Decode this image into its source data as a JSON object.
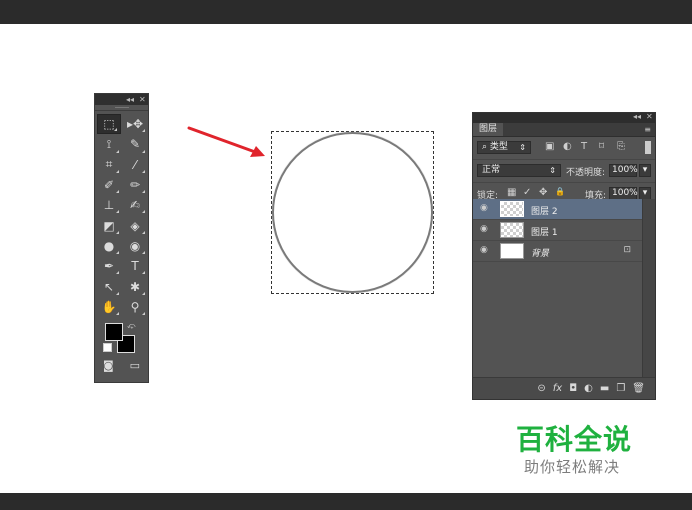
{
  "tools_panel": {
    "collapse_glyph": "◂◂",
    "close_glyph": "✕",
    "tools": [
      {
        "name": "rect-marquee-tool-icon",
        "glyph": "⬚",
        "selected": true
      },
      {
        "name": "move-tool-icon",
        "glyph": "▸✥"
      },
      {
        "name": "lasso-tool-icon",
        "glyph": "⟟"
      },
      {
        "name": "quick-select-tool-icon",
        "glyph": "✎"
      },
      {
        "name": "crop-tool-icon",
        "glyph": "⌗"
      },
      {
        "name": "eyedropper-tool-icon",
        "glyph": "⁄"
      },
      {
        "name": "healing-brush-tool-icon",
        "glyph": "✐"
      },
      {
        "name": "brush-tool-icon",
        "glyph": "✏"
      },
      {
        "name": "clone-stamp-tool-icon",
        "glyph": "⊥"
      },
      {
        "name": "history-brush-tool-icon",
        "glyph": "✍"
      },
      {
        "name": "eraser-tool-icon",
        "glyph": "◩"
      },
      {
        "name": "paint-bucket-tool-icon",
        "glyph": "◈"
      },
      {
        "name": "blur-tool-icon",
        "glyph": "●"
      },
      {
        "name": "dodge-tool-icon",
        "glyph": "◉"
      },
      {
        "name": "pen-tool-icon",
        "glyph": "✒"
      },
      {
        "name": "type-tool-icon",
        "text": "T"
      },
      {
        "name": "path-select-tool-icon",
        "glyph": "↖"
      },
      {
        "name": "custom-shape-tool-icon",
        "glyph": "✱"
      },
      {
        "name": "hand-tool-icon",
        "glyph": "✋"
      },
      {
        "name": "zoom-tool-icon",
        "glyph": "⚲"
      }
    ],
    "foreground_color": "#000000",
    "background_color": "#000000",
    "quickmask_glyph": "◙",
    "screenmode_glyph": "▭"
  },
  "canvas": {
    "arrow_color": "#e0242c",
    "circle_stroke": "#7a7a7a"
  },
  "layers_panel": {
    "collapse_glyph": "◂◂",
    "close_glyph": "✕",
    "tab_label": "图层",
    "menu_glyph": "≡",
    "filter": {
      "search_glyph": "⌕",
      "label": "类型",
      "icons": [
        "▣",
        "◐",
        "T",
        "⌑",
        "⎘"
      ]
    },
    "blend_mode": "正常",
    "opacity_label": "不透明度:",
    "opacity_value": "100%",
    "lock_label": "锁定:",
    "lock_icons": [
      "▦",
      "✓",
      "✥",
      "🔒"
    ],
    "fill_label": "填充:",
    "fill_value": "100%",
    "layers": [
      {
        "name": "图层 2",
        "active": true,
        "thumb": "transparent"
      },
      {
        "name": "图层 1",
        "active": false,
        "thumb": "transparent"
      },
      {
        "name": "背景",
        "active": false,
        "thumb": "white",
        "locked": true
      }
    ],
    "footer_icons": [
      "⊝",
      "fx",
      "◘",
      "◐",
      "▬",
      "❐",
      "🗑"
    ]
  },
  "watermark": {
    "title": "百科全说",
    "subtitle": "助你轻松解决",
    "title_color": "#1fb13f"
  }
}
